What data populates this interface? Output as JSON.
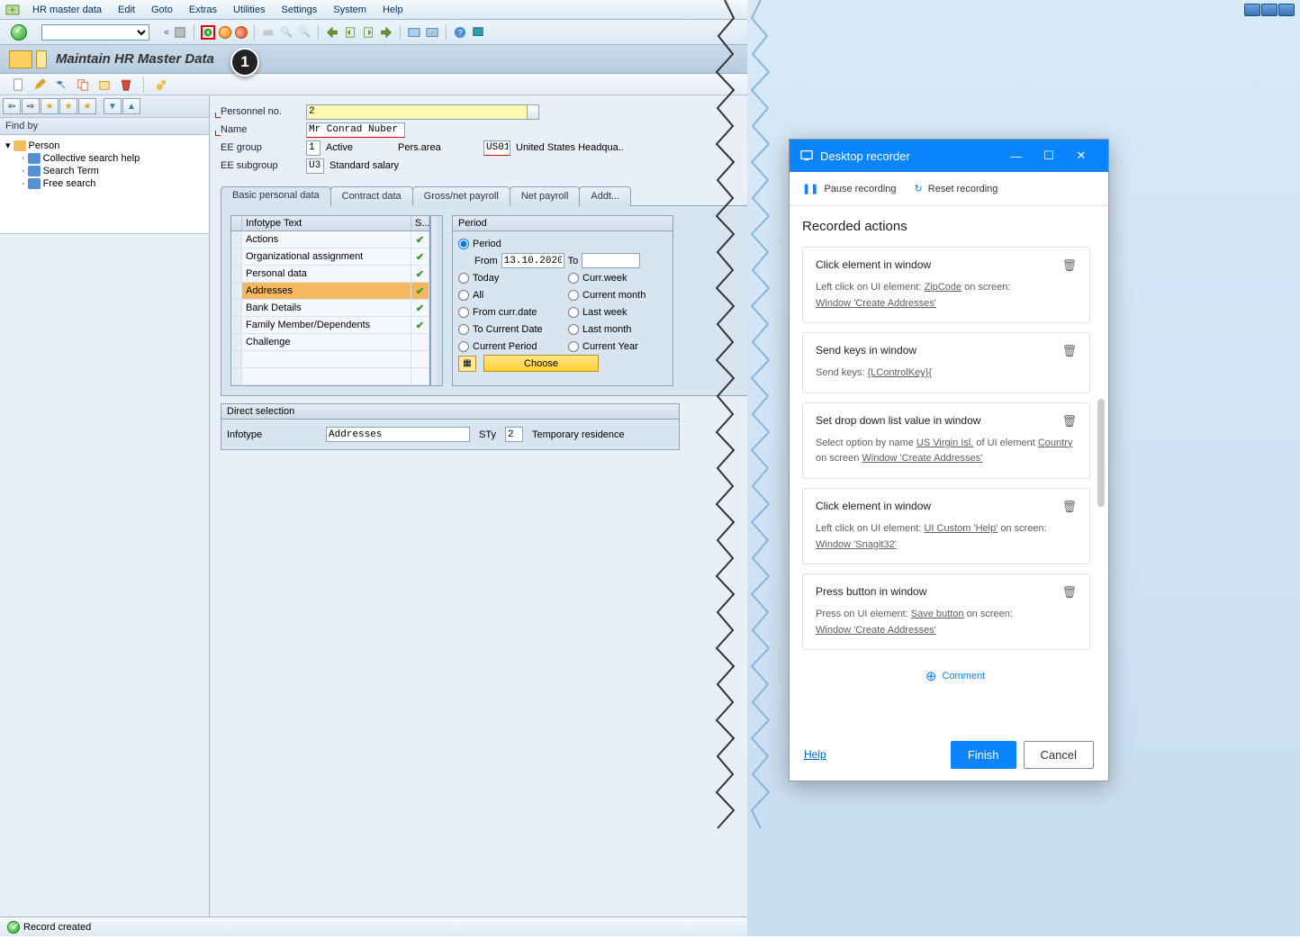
{
  "menu": {
    "items": [
      "HR master data",
      "Edit",
      "Goto",
      "Extras",
      "Utilities",
      "Settings",
      "System",
      "Help"
    ]
  },
  "title": "Maintain HR Master Data",
  "findby": "Find by",
  "tree": {
    "person": "Person",
    "collective": "Collective search help",
    "search": "Search Term",
    "free": "Free search"
  },
  "fields": {
    "personnel_no_label": "Personnel no.",
    "personnel_no": "2",
    "name_label": "Name",
    "name": "Mr Conrad Nuber",
    "eegroup_label": "EE group",
    "eegroup": "1",
    "eegroup_t": "Active",
    "persarea_label": "Pers.area",
    "persarea": "US01",
    "persarea_t": "United States Headqua..",
    "eesub_label": "EE subgroup",
    "eesub": "U3",
    "eesub_t": "Standard salary"
  },
  "tabs": {
    "t1": "Basic personal data",
    "t2": "Contract data",
    "t3": "Gross/net payroll",
    "t4": "Net payroll",
    "t5": "Addt..."
  },
  "info": {
    "h1": "Infotype Text",
    "h2": "S...",
    "r1": "Actions",
    "r2": "Organizational assignment",
    "r3": "Personal data",
    "r4": "Addresses",
    "r5": "Bank Details",
    "r6": "Family Member/Dependents",
    "r7": "Challenge"
  },
  "period": {
    "head": "Period",
    "period": "Period",
    "from": "From",
    "from_v": "13.10.2020",
    "to": "To",
    "today": "Today",
    "cw": "Curr.week",
    "all": "All",
    "cm": "Current month",
    "fcd": "From curr.date",
    "lw": "Last week",
    "tcd": "To Current Date",
    "lm": "Last month",
    "cp": "Current Period",
    "cy": "Current Year",
    "choose": "Choose"
  },
  "direct": {
    "head": "Direct selection",
    "infotype": "Infotype",
    "infotype_v": "Addresses",
    "sty": "STy",
    "sty_v": "2",
    "sty_t": "Temporary residence"
  },
  "status": "Record created",
  "recorder": {
    "title": "Desktop recorder",
    "pause": "Pause recording",
    "reset": "Reset recording",
    "recorded": "Recorded actions",
    "a1_h": "Click element in window",
    "a1_b1": "Left click on UI element:",
    "a1_el": "ZipCode",
    "a1_b2": "on screen:",
    "a1_win": "Window 'Create Addresses'",
    "a2_h": "Send keys in window",
    "a2_b1": "Send keys:",
    "a2_keys": "{LControlKey}{",
    "a3_h": "Set drop down list value in window",
    "a3_b1": "Select option by name",
    "a3_opt": "US Virgin Isl.",
    "a3_b2": "of UI element",
    "a3_el": "Country",
    "a3_b3": "on screen",
    "a3_win": "Window 'Create Addresses'",
    "a4_h": "Click element in window",
    "a4_b1": "Left click on UI element:",
    "a4_el": "UI Custom 'Help'",
    "a4_b2": "on screen:",
    "a4_win": "Window 'Snagit32'",
    "a5_h": "Press button in window",
    "a5_b1": "Press on UI element:",
    "a5_el": "Save button",
    "a5_b2": "on screen:",
    "a5_win": "Window 'Create Addresses'",
    "comment": "Comment",
    "help": "Help",
    "finish": "Finish",
    "cancel": "Cancel"
  },
  "callout": "1"
}
